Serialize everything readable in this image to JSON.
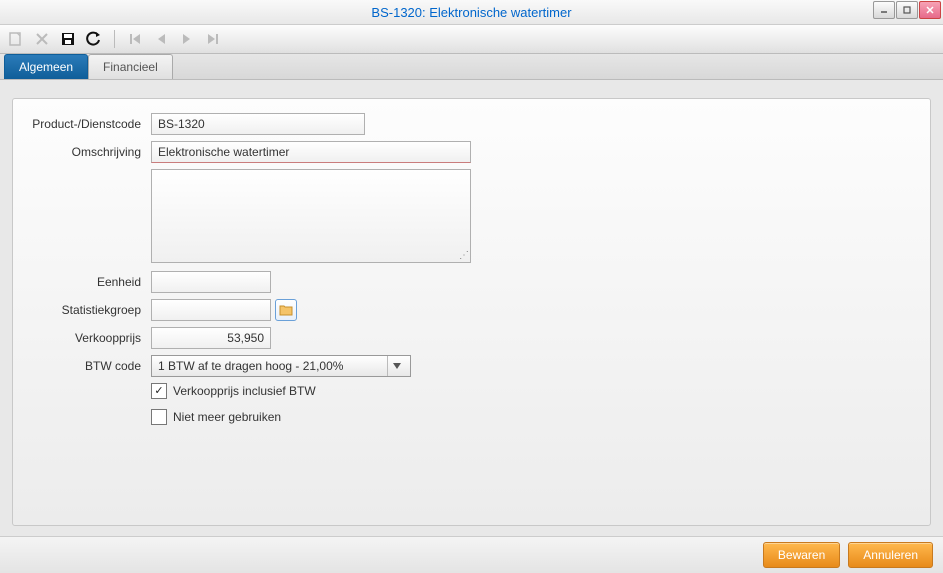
{
  "title": "BS-1320: Elektronische watertimer",
  "tabs": {
    "general": "Algemeen",
    "financial": "Financieel"
  },
  "labels": {
    "code": "Product-/Dienstcode",
    "desc": "Omschrijving",
    "unit": "Eenheid",
    "stat": "Statistiekgroep",
    "price": "Verkoopprijs",
    "vat": "BTW code"
  },
  "values": {
    "code": "BS-1320",
    "desc": "Elektronische watertimer",
    "longdesc": "",
    "unit": "",
    "stat": "",
    "price": "53,950",
    "vat": "1 BTW af te dragen hoog - 21,00%"
  },
  "checks": {
    "incl": "Verkoopprijs inclusief BTW",
    "dontuse": "Niet meer gebruiken"
  },
  "footer": {
    "save": "Bewaren",
    "cancel": "Annuleren"
  }
}
